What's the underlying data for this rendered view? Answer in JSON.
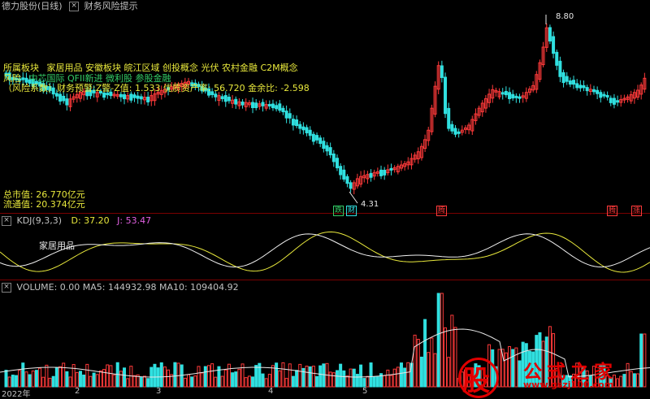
{
  "window": {
    "stock_label": "德力股份(日线)",
    "indicator_label": "财务风险提示"
  },
  "colors": {
    "up": "#ff3a3a",
    "down": "#30e0e0",
    "kdj_k": "#f0f0f0",
    "kdj_d": "#e8e83c",
    "grid_sep": "#7a0000"
  },
  "info": {
    "sector_label": "所属板块",
    "sectors_line1": "家居用品   安徽板块   皖江区域 创投概念 光伏 农村金融 C2M概念",
    "sectors_line2_prefix": "风险",
    "sectors_line2": "中芯国际 QFII新进 微利股 参股金融",
    "risk_line": "（风险系数）财务预警:Z警-Z值: 1.533  优质资产率: 56.720  金余比: -2.598"
  },
  "price_pane": {
    "high_label": "8.80",
    "low_label": "4.31",
    "market_cap": "总市值: 26.770亿元",
    "float_cap": "流通值: 20.374亿元",
    "badges": [
      {
        "text": "跌",
        "color": "#33cc66"
      },
      {
        "text": "财",
        "color": "#30e0e0"
      },
      {
        "text": "腾",
        "color": "#ff3a3a"
      },
      {
        "text": "腾",
        "color": "#ff3a3a"
      },
      {
        "text": "涨",
        "color": "#ff3a3a"
      }
    ]
  },
  "kdj_pane": {
    "name": "KDJ(9,3,3)",
    "d_value": "D: 37.20",
    "j_value": "J: 53.47",
    "overlay_label": "家居用品"
  },
  "volume_pane": {
    "header": "VOLUME: 0.00  MA5: 144932.98  MA10: 109404.92"
  },
  "x_axis": {
    "labels": [
      "2022年",
      "2",
      "3",
      "4",
      "5"
    ]
  },
  "watermark": {
    "logo_char": "股",
    "brand": "公式之家",
    "url": "www.gszj100.com"
  }
}
